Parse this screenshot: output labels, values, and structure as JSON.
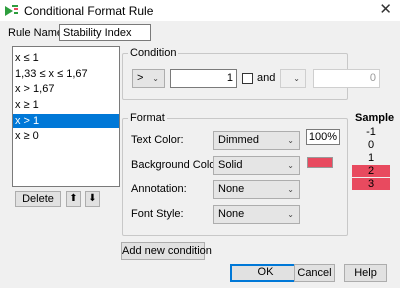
{
  "window": {
    "title": "Conditional Format Rule",
    "close_symbol": "✕",
    "accent": "#0078d7"
  },
  "rule_name": {
    "label": "Rule Name:",
    "value": "Stability Index"
  },
  "rules": [
    {
      "label": "x ≤ 1",
      "selected": false
    },
    {
      "label": "1,33 ≤ x ≤ 1,67",
      "selected": false
    },
    {
      "label": "x > 1,67",
      "selected": false
    },
    {
      "label": "x ≥ 1",
      "selected": false
    },
    {
      "label": "x > 1",
      "selected": true
    },
    {
      "label": "x ≥ 0",
      "selected": false
    }
  ],
  "list_buttons": {
    "delete": "Delete",
    "up": "⬆",
    "down": "⬇"
  },
  "condition": {
    "title": "Condition",
    "operator": ">",
    "value1": "1",
    "and_label": "and",
    "operator2": "",
    "value2": "0",
    "chevron": "⌄"
  },
  "format": {
    "title": "Format",
    "text_color_label": "Text Color:",
    "text_color_value": "Dimmed",
    "text_percent": "100%",
    "background_label": "Background Color:",
    "background_value": "Solid",
    "background_color": "#e84a5f",
    "annotation_label": "Annotation:",
    "annotation_value": "None",
    "font_style_label": "Font Style:",
    "font_style_value": "None"
  },
  "sample": {
    "title": "Sample",
    "values": [
      {
        "v": "-1",
        "highlight": false
      },
      {
        "v": "0",
        "highlight": false
      },
      {
        "v": "1",
        "highlight": false
      },
      {
        "v": "2",
        "highlight": true
      },
      {
        "v": "3",
        "highlight": true
      }
    ]
  },
  "add_condition": "Add new condition",
  "footer": {
    "ok": "OK",
    "cancel": "Cancel",
    "help": "Help"
  }
}
